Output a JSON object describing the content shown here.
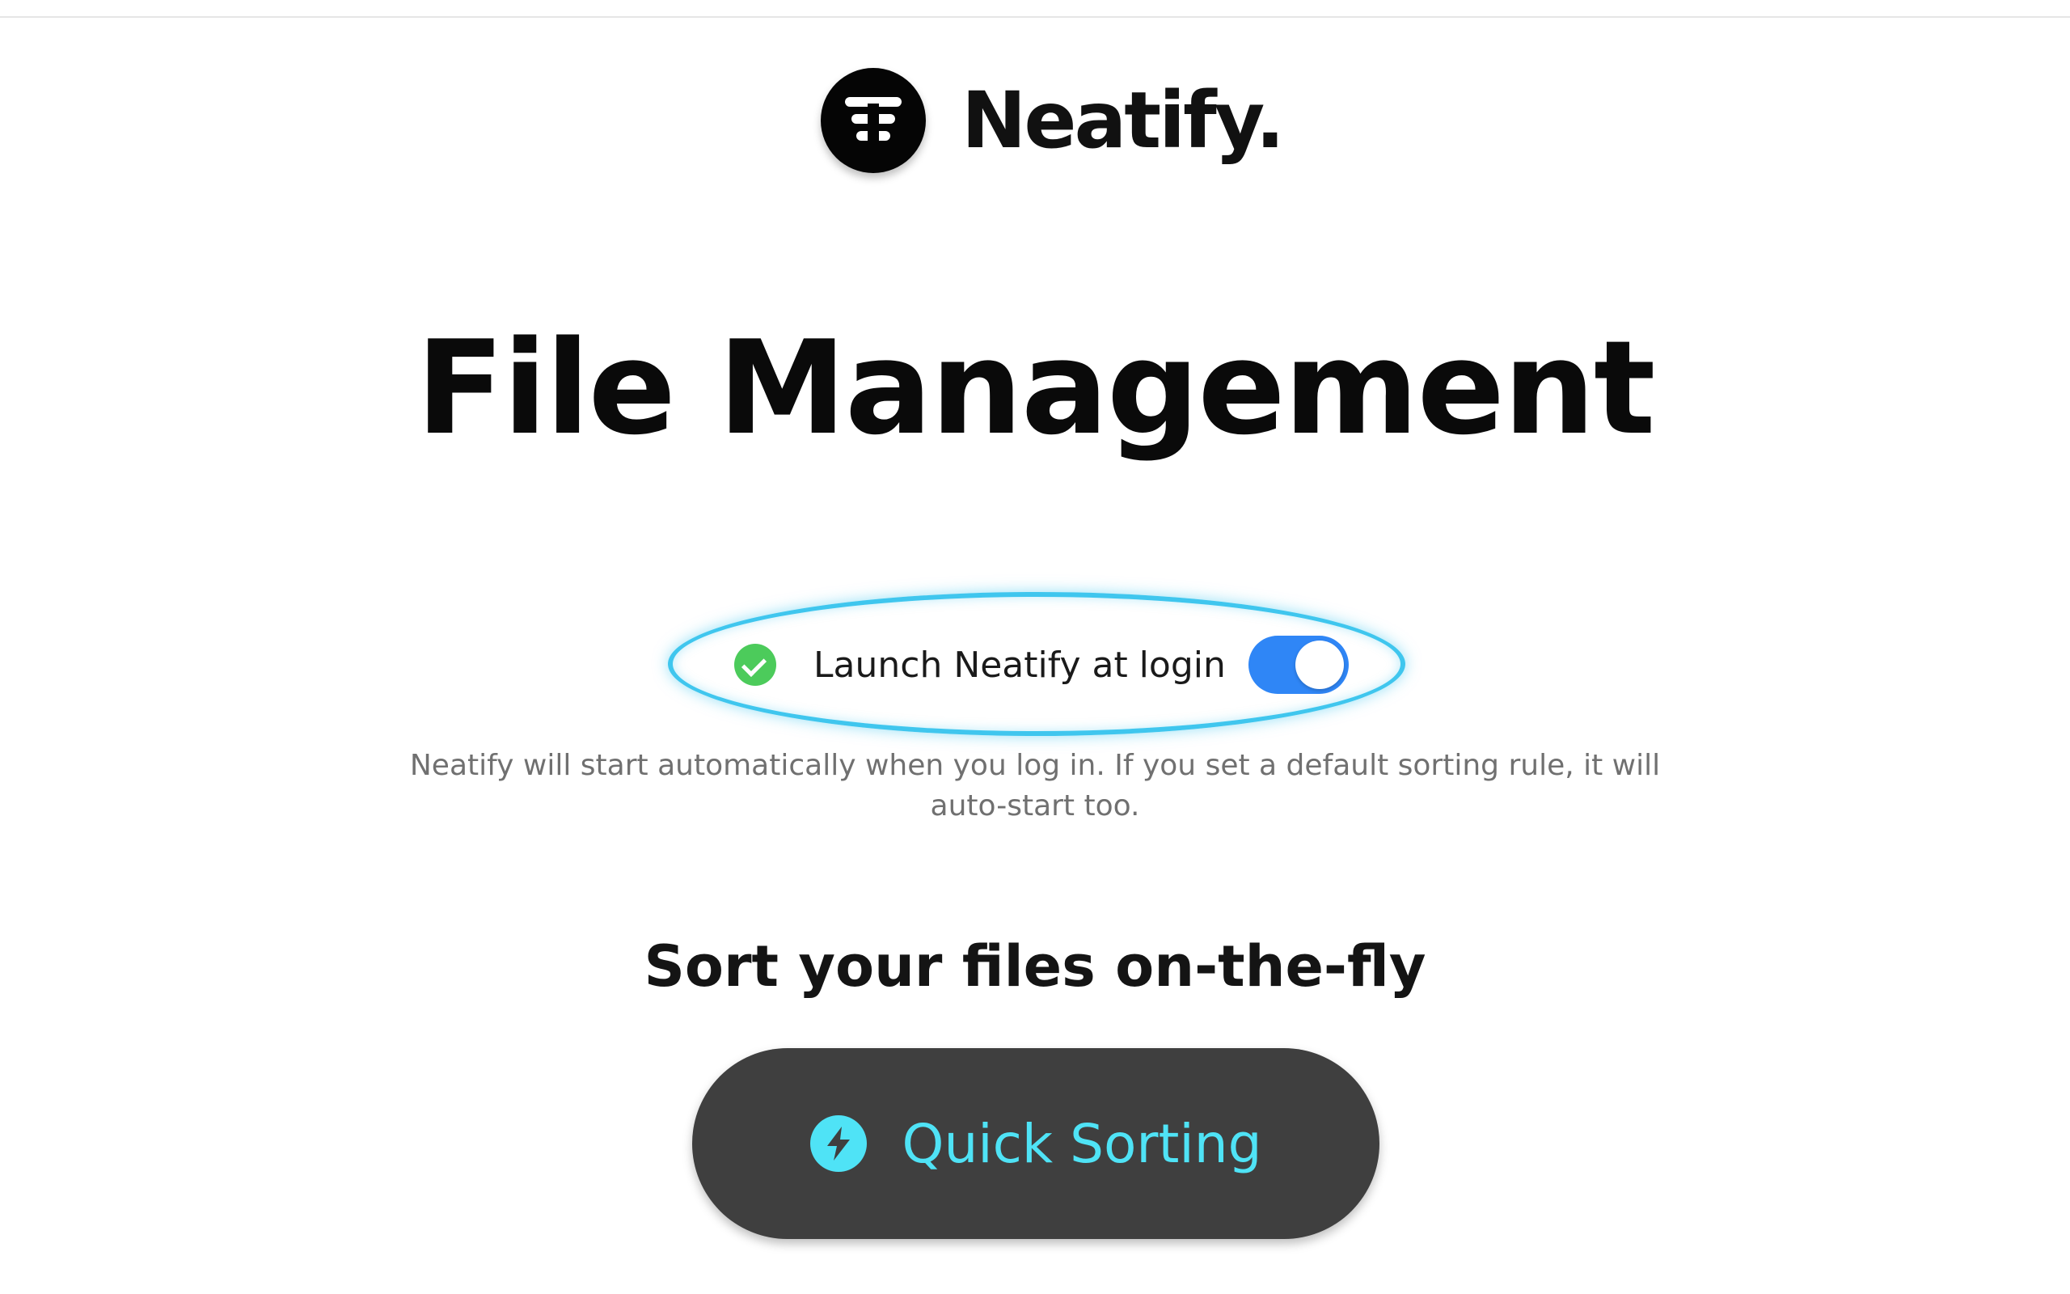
{
  "brand": {
    "name": "Neatify.",
    "logo_icon": "stacked-lines-logo"
  },
  "main": {
    "title": "File Management",
    "launch": {
      "label": "Launch Neatify at login",
      "enabled": true,
      "status_icon": "check-circle-icon",
      "description": "Neatify will start automatically when you log in. If you set a default sorting rule, it will auto-start too."
    },
    "sort": {
      "heading": "Sort your files on-the-fly",
      "button_label": "Quick Sorting",
      "button_icon": "lightning-bolt-icon"
    }
  },
  "colors": {
    "accent_cyan": "#4fe3f6",
    "toggle_blue": "#2f86f6",
    "check_green": "#4ccb5b",
    "button_dark": "#3f3f3f",
    "highlight_ring": "#3fc6ee"
  }
}
